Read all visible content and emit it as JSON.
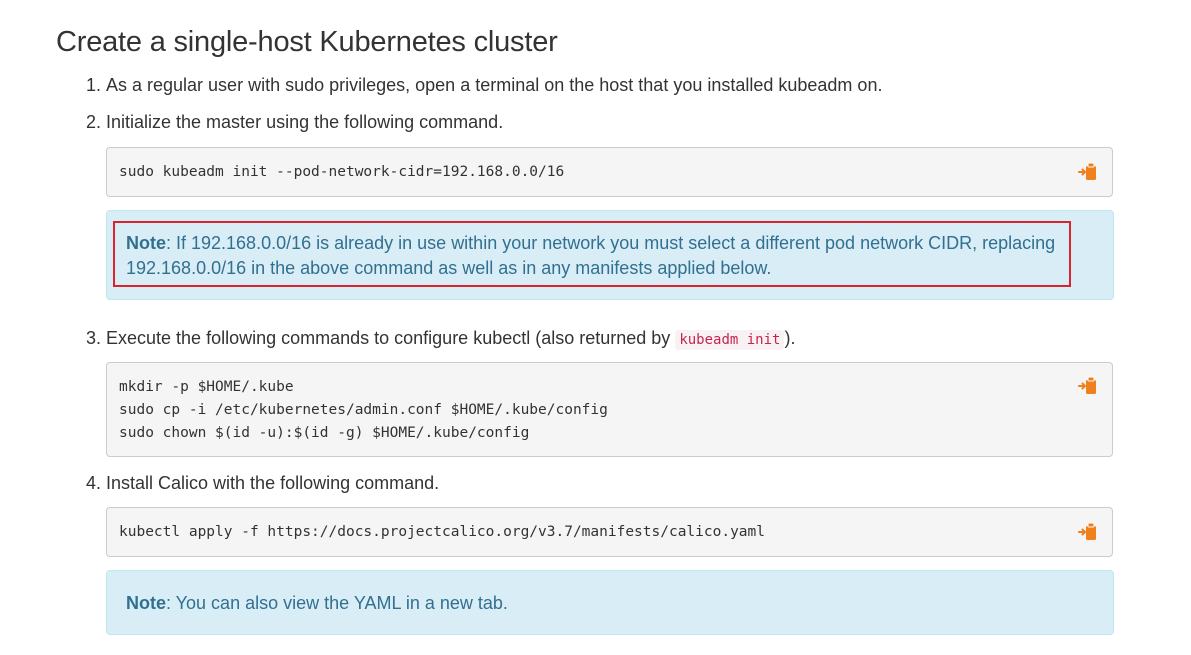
{
  "title": "Create a single-host Kubernetes cluster",
  "steps": [
    {
      "num": "1.",
      "text": "As a regular user with sudo privileges, open a terminal on the host that you installed kubeadm on."
    },
    {
      "num": "2.",
      "text": "Initialize the master using the following command."
    },
    {
      "num": "3.",
      "text_before": "Execute the following commands to configure kubectl (also returned by ",
      "code": "kubeadm init",
      "text_after": ")."
    },
    {
      "num": "4.",
      "text": "Install Calico with the following command."
    }
  ],
  "code_blocks": [
    {
      "lines": [
        "sudo kubeadm init --pod-network-cidr=192.168.0.0/16"
      ]
    },
    {
      "lines": [
        "mkdir -p $HOME/.kube",
        "sudo cp -i /etc/kubernetes/admin.conf $HOME/.kube/config",
        "sudo chown $(id -u):$(id -g) $HOME/.kube/config"
      ]
    },
    {
      "lines": [
        "kubectl apply -f https://docs.projectcalico.org/v3.7/manifests/calico.yaml"
      ]
    }
  ],
  "notes": [
    {
      "label": "Note",
      "line1": ": If 192.168.0.0/16 is already in use within your network you must select a different pod network CIDR, replacing",
      "line2": "192.168.0.0/16 in the above command as well as in any manifests applied below."
    },
    {
      "label": "Note",
      "text_before": ": You can also ",
      "link": "view the YAML in a new tab",
      "text_after": "."
    }
  ],
  "icons": {
    "copy": "copy-to-clipboard-icon"
  },
  "colors": {
    "copy_icon": "#f07f1e",
    "note_bg": "#d9edf7",
    "note_text": "#31708f",
    "highlight_border": "#d9242f",
    "inline_code": "#c7254e"
  }
}
